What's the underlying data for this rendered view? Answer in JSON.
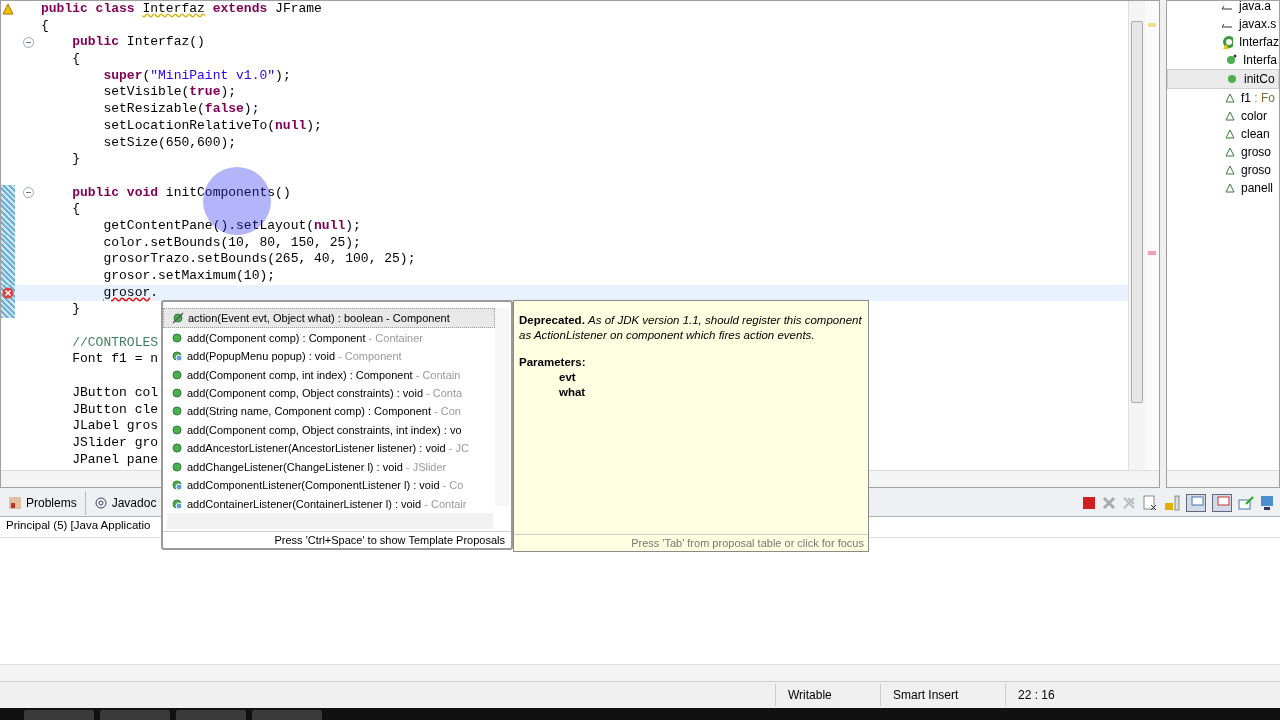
{
  "editor": {
    "lines": [
      {
        "kind": "code",
        "annotation": {
          "kind": "warning"
        },
        "fold": false,
        "changed": false,
        "current": false,
        "tokens": [
          {
            "kind": "kw",
            "text": "public "
          },
          {
            "kind": "kw",
            "text": "class "
          },
          {
            "kind": "warn",
            "text": "Interfaz"
          },
          {
            "kind": "kw",
            "text": " extends"
          },
          {
            "kind": "plain",
            "text": " JFrame"
          }
        ]
      },
      {
        "kind": "code",
        "fold": false,
        "changed": false,
        "current": false,
        "tokens": [
          {
            "kind": "plain",
            "text": "{"
          }
        ]
      },
      {
        "kind": "code",
        "fold": true,
        "changed": false,
        "current": false,
        "tokens": [
          {
            "kind": "kw",
            "text": "    public"
          },
          {
            "kind": "plain",
            "text": " Interfaz()"
          }
        ]
      },
      {
        "kind": "code",
        "fold": false,
        "changed": false,
        "current": false,
        "tokens": [
          {
            "kind": "plain",
            "text": "    {"
          }
        ]
      },
      {
        "kind": "code",
        "fold": false,
        "changed": false,
        "current": false,
        "tokens": [
          {
            "kind": "kw",
            "text": "        super"
          },
          {
            "kind": "plain",
            "text": "("
          },
          {
            "kind": "str",
            "text": "\"MiniPaint v1.0\""
          },
          {
            "kind": "plain",
            "text": ");"
          }
        ]
      },
      {
        "kind": "code",
        "fold": false,
        "changed": false,
        "current": false,
        "tokens": [
          {
            "kind": "plain",
            "text": "        setVisible("
          },
          {
            "kind": "kw",
            "text": "true"
          },
          {
            "kind": "plain",
            "text": ");"
          }
        ]
      },
      {
        "kind": "code",
        "fold": false,
        "changed": false,
        "current": false,
        "tokens": [
          {
            "kind": "plain",
            "text": "        setResizable("
          },
          {
            "kind": "kw",
            "text": "false"
          },
          {
            "kind": "plain",
            "text": ");"
          }
        ]
      },
      {
        "kind": "code",
        "fold": false,
        "changed": false,
        "current": false,
        "tokens": [
          {
            "kind": "plain",
            "text": "        setLocationRelativeTo("
          },
          {
            "kind": "kw",
            "text": "null"
          },
          {
            "kind": "plain",
            "text": ");"
          }
        ]
      },
      {
        "kind": "code",
        "fold": false,
        "changed": false,
        "current": false,
        "tokens": [
          {
            "kind": "plain",
            "text": "        setSize(650,600);"
          }
        ]
      },
      {
        "kind": "code",
        "fold": false,
        "changed": false,
        "current": false,
        "tokens": [
          {
            "kind": "plain",
            "text": "    }"
          }
        ]
      },
      {
        "kind": "blank",
        "changed": false
      },
      {
        "kind": "code",
        "fold": true,
        "changed": true,
        "current": false,
        "tokens": [
          {
            "kind": "kw",
            "text": "    public "
          },
          {
            "kind": "kw",
            "text": "void"
          },
          {
            "kind": "plain",
            "text": " initComponents()"
          }
        ]
      },
      {
        "kind": "code",
        "fold": false,
        "changed": true,
        "current": false,
        "tokens": [
          {
            "kind": "plain",
            "text": "    {"
          }
        ]
      },
      {
        "kind": "code",
        "fold": false,
        "changed": true,
        "current": false,
        "tokens": [
          {
            "kind": "plain",
            "text": "        getContentPane().setLayout("
          },
          {
            "kind": "kw",
            "text": "null"
          },
          {
            "kind": "plain",
            "text": ");"
          }
        ]
      },
      {
        "kind": "code",
        "fold": false,
        "changed": true,
        "current": false,
        "tokens": [
          {
            "kind": "plain",
            "text": "        color.setBounds(10, 80, 150, 25);"
          }
        ]
      },
      {
        "kind": "code",
        "fold": false,
        "changed": true,
        "current": false,
        "tokens": [
          {
            "kind": "plain",
            "text": "        grosorTrazo.setBounds(265, 40, 100, 25);"
          }
        ]
      },
      {
        "kind": "code",
        "fold": false,
        "changed": true,
        "current": false,
        "tokens": [
          {
            "kind": "plain",
            "text": "        grosor.setMaximum(10);"
          }
        ]
      },
      {
        "kind": "code",
        "annotation": {
          "kind": "error"
        },
        "fold": false,
        "changed": true,
        "current": true,
        "tokens": [
          {
            "kind": "error",
            "text": "        grosor"
          },
          {
            "kind": "plain",
            "text": "."
          }
        ]
      },
      {
        "kind": "code",
        "fold": false,
        "changed": true,
        "current": false,
        "tokens": [
          {
            "kind": "plain",
            "text": "    }"
          }
        ]
      },
      {
        "kind": "blank",
        "changed": false
      },
      {
        "kind": "code",
        "fold": false,
        "changed": false,
        "current": false,
        "tokens": [
          {
            "kind": "comment",
            "text": "    //CONTROLES"
          }
        ]
      },
      {
        "kind": "code",
        "fold": false,
        "changed": false,
        "current": false,
        "tokens": [
          {
            "kind": "plain",
            "text": "    Font f1 = n"
          }
        ]
      },
      {
        "kind": "blank",
        "changed": false
      },
      {
        "kind": "code",
        "fold": false,
        "changed": false,
        "current": false,
        "tokens": [
          {
            "kind": "plain",
            "text": "    JButton col"
          }
        ]
      },
      {
        "kind": "code",
        "fold": false,
        "changed": false,
        "current": false,
        "tokens": [
          {
            "kind": "plain",
            "text": "    JButton cle"
          }
        ]
      },
      {
        "kind": "code",
        "fold": false,
        "changed": false,
        "current": false,
        "tokens": [
          {
            "kind": "plain",
            "text": "    JLabel gros"
          }
        ]
      },
      {
        "kind": "code",
        "fold": false,
        "changed": false,
        "current": false,
        "tokens": [
          {
            "kind": "plain",
            "text": "    JSlider gro"
          }
        ]
      },
      {
        "kind": "code",
        "fold": false,
        "changed": false,
        "current": false,
        "tokens": [
          {
            "kind": "plain",
            "text": "    JPanel pane"
          }
        ]
      }
    ]
  },
  "outline": {
    "items": [
      {
        "kind": "import",
        "label": "java.a",
        "selected": false
      },
      {
        "kind": "import",
        "label": "javax.s",
        "selected": false
      },
      {
        "kind": "class",
        "label": "Interfaz",
        "selected": false,
        "children": [
          {
            "kind": "constructor",
            "label": "Interfa",
            "selected": false
          },
          {
            "kind": "method",
            "label": "initCo",
            "selected": true
          },
          {
            "kind": "field",
            "label": "f1",
            "type": " : Fo",
            "selected": false
          },
          {
            "kind": "field",
            "label": "color",
            "selected": false
          },
          {
            "kind": "field",
            "label": "clean",
            "selected": false
          },
          {
            "kind": "field",
            "label": "groso",
            "selected": false
          },
          {
            "kind": "field",
            "label": "groso",
            "selected": false
          },
          {
            "kind": "field",
            "label": "panell",
            "selected": false
          }
        ]
      }
    ]
  },
  "bottom_panel": {
    "tabs": [
      {
        "label": "Problems",
        "kind": "problems",
        "selected": false
      },
      {
        "label": "Javadoc",
        "kind": "javadoc",
        "selected": false
      }
    ],
    "console_title": "Principal (5) [Java Applicatio"
  },
  "proposals": {
    "items": [
      {
        "kind": "deprecated",
        "signature": "action(Event evt, Object what) : boolean - Component",
        "selected": true
      },
      {
        "kind": "public",
        "signature": "add(Component comp) : Component",
        "owner": " - Container",
        "selected": false
      },
      {
        "kind": "protected",
        "signature": "add(PopupMenu popup) : void",
        "owner": " - Component",
        "selected": false
      },
      {
        "kind": "public",
        "signature": "add(Component comp, int index) : Component",
        "owner": " - Contain",
        "selected": false
      },
      {
        "kind": "public",
        "signature": "add(Component comp, Object constraints) : void",
        "owner": " - Conta",
        "selected": false
      },
      {
        "kind": "public",
        "signature": "add(String name, Component comp) : Component",
        "owner": " - Con",
        "selected": false
      },
      {
        "kind": "public",
        "signature": "add(Component comp, Object constraints, int index) : vo",
        "selected": false
      },
      {
        "kind": "public",
        "signature": "addAncestorListener(AncestorListener listener) : void",
        "owner": " - JC",
        "selected": false
      },
      {
        "kind": "public",
        "signature": "addChangeListener(ChangeListener l) : void",
        "owner": " - JSlider",
        "selected": false
      },
      {
        "kind": "protected",
        "signature": "addComponentListener(ComponentListener l) : void",
        "owner": " - Co",
        "selected": false
      },
      {
        "kind": "protected",
        "signature": "addContainerListener(ContainerListener l) : void",
        "owner": " - Contair",
        "selected": false
      }
    ],
    "footer": "Press 'Ctrl+Space' to show Template Proposals"
  },
  "javadoc": {
    "text": "**Deprecated.** *As of JDK version 1.1, should register this component as ActionListener on component which fires action events.*",
    "params_heading": "Parameters:",
    "params": [
      "evt",
      "what"
    ],
    "footer": "Press 'Tab' from proposal table or click for focus"
  },
  "status_bar": {
    "items": [
      "Writable",
      "Smart Insert",
      "22 : 16"
    ]
  }
}
